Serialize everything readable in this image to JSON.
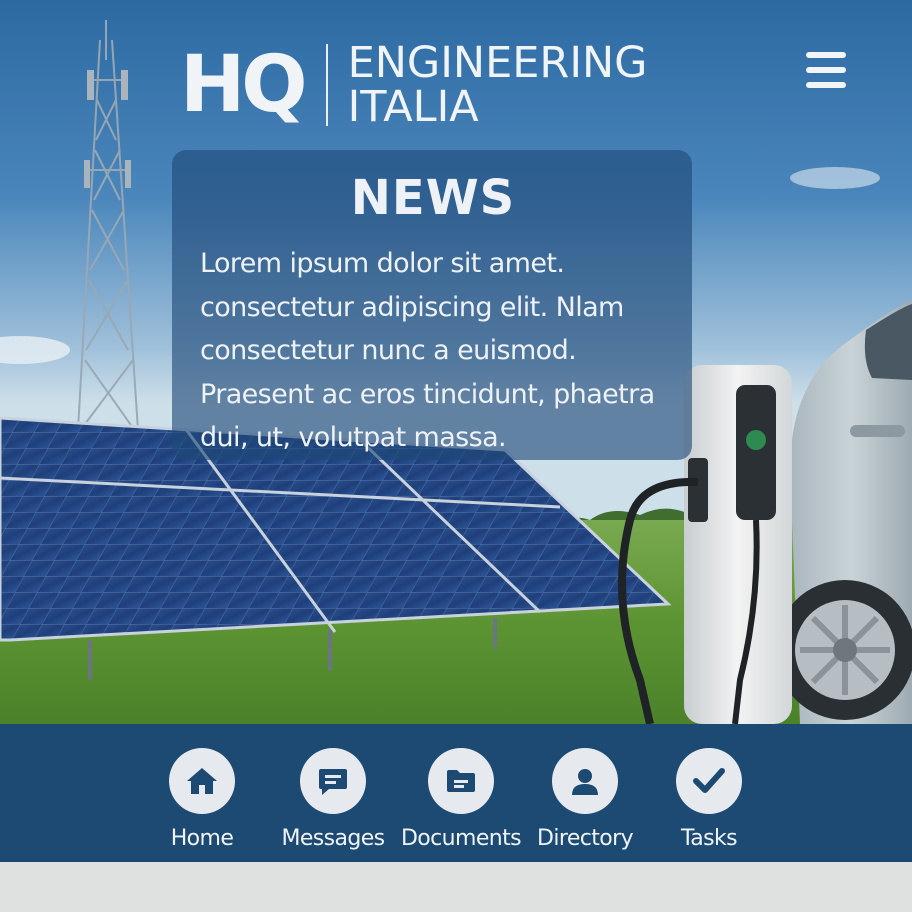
{
  "brand": {
    "mark": "HQ",
    "name_line1": "ENGINEERING",
    "name_line2": "ITALIA"
  },
  "header": {
    "menu_icon": "hamburger-menu-icon"
  },
  "news": {
    "title": "NEWS",
    "lines": [
      "Lorem ipsum dolor sit amet.",
      "consectetur adipiscing elit. Nlam",
      "consectetur nunc a euismod.",
      "Praesent ac eros tincidunt, phaetra",
      "dui, ut, volutpat massa."
    ]
  },
  "nav": {
    "items": [
      {
        "label": "Home",
        "icon": "home-icon"
      },
      {
        "label": "Messages",
        "icon": "chat-bubble-icon"
      },
      {
        "label": "Documents",
        "icon": "folder-icon"
      },
      {
        "label": "Directory",
        "icon": "person-icon"
      },
      {
        "label": "Tasks",
        "icon": "checkmark-icon"
      }
    ]
  },
  "colors": {
    "nav_background": "#1d4a72",
    "icon_circle": "#e6eaee",
    "icon_color": "#1d4a72",
    "panel_overlay": "#1e4878",
    "text_light": "#eef2f6"
  }
}
